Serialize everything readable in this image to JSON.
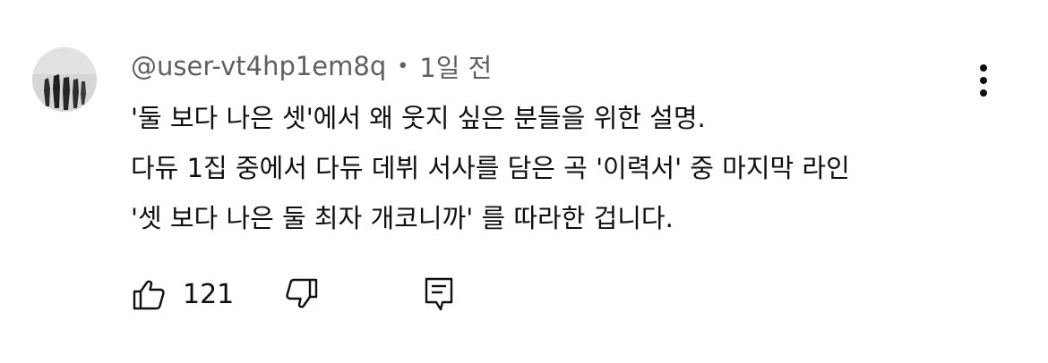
{
  "comment": {
    "author": "@user-vt4hp1em8q",
    "separator": "•",
    "timestamp": "1일 전",
    "lines": [
      "'둘 보다 나은 셋'에서 왜 웃지 싶은 분들을 위한 설명.",
      "다듀 1집 중에서 다듀 데뷔 서사를 담은 곡 '이력서' 중 마지막 라인",
      "'셋 보다 나은 둘 최자 개코니까' 를 따라한 겁니다."
    ],
    "like_count": "121"
  },
  "icons": {
    "avatar": "avatar-image",
    "more": "more-vertical-icon",
    "like": "thumbs-up-icon",
    "dislike": "thumbs-down-icon",
    "reply": "reply-comment-icon"
  },
  "colors": {
    "text_primary": "#0f0f0f",
    "text_secondary": "#606060",
    "background": "#ffffff"
  }
}
